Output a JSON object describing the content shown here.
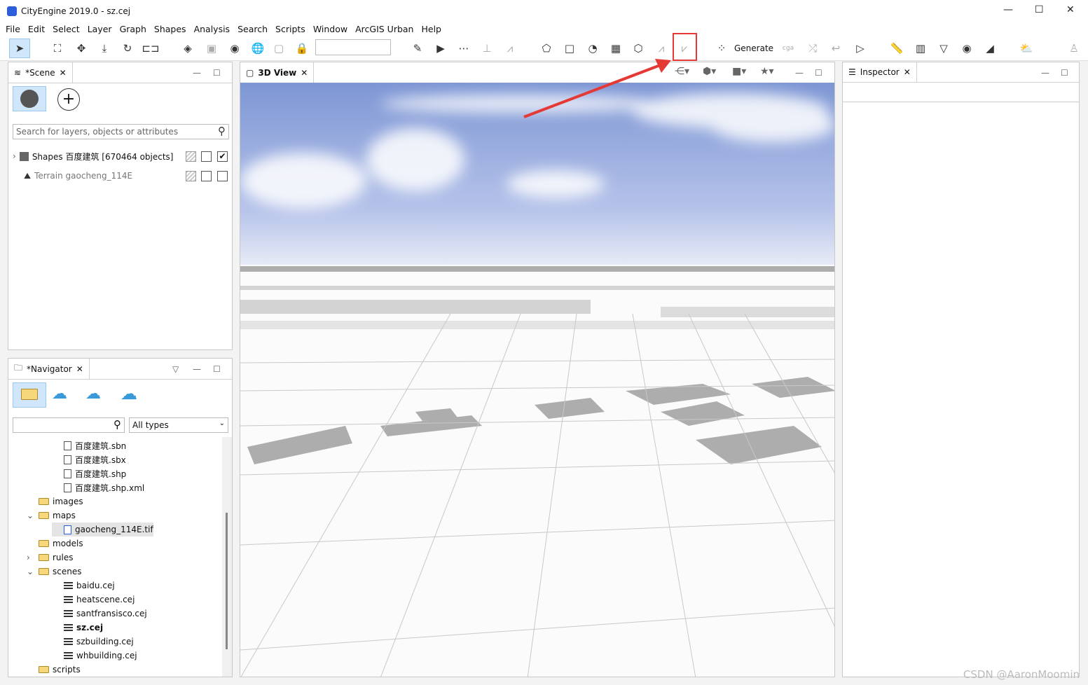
{
  "window": {
    "title": "CityEngine 2019.0 - sz.cej"
  },
  "menu": [
    "File",
    "Edit",
    "Select",
    "Layer",
    "Graph",
    "Shapes",
    "Analysis",
    "Search",
    "Scripts",
    "Window",
    "ArcGIS Urban",
    "Help"
  ],
  "toolbar": {
    "generate_label": "Generate",
    "cga_label": "cga",
    "highlight_color": "#e53935"
  },
  "scene": {
    "tab": "*Scene",
    "search_placeholder": "Search for layers, objects or attributes",
    "layers": [
      {
        "label": "Shapes 百度建筑 [670464 objects]",
        "visible": true,
        "icon": "cube-icon"
      },
      {
        "label": "Terrain gaocheng_114E",
        "visible": false,
        "icon": "terrain-icon"
      }
    ]
  },
  "navigator": {
    "tab": "*Navigator",
    "filter_value": "All types",
    "items": [
      {
        "label": "百度建筑.sbn",
        "type": "file",
        "indent": 3
      },
      {
        "label": "百度建筑.sbx",
        "type": "file",
        "indent": 3
      },
      {
        "label": "百度建筑.shp",
        "type": "shp",
        "indent": 3
      },
      {
        "label": "百度建筑.shp.xml",
        "type": "file",
        "indent": 3
      },
      {
        "label": "images",
        "type": "folder",
        "indent": 2
      },
      {
        "label": "maps",
        "type": "folder-open",
        "indent": 2
      },
      {
        "label": "gaocheng_114E.tif",
        "type": "image",
        "indent": 3,
        "selected": true
      },
      {
        "label": "models",
        "type": "folder",
        "indent": 2
      },
      {
        "label": "rules",
        "type": "folder-collapsed",
        "indent": 2
      },
      {
        "label": "scenes",
        "type": "folder-open",
        "indent": 2
      },
      {
        "label": "baidu.cej",
        "type": "scene",
        "indent": 3
      },
      {
        "label": "heatscene.cej",
        "type": "scene",
        "indent": 3
      },
      {
        "label": "santfransisco.cej",
        "type": "scene",
        "indent": 3
      },
      {
        "label": "sz.cej",
        "type": "scene",
        "indent": 3,
        "bold": true
      },
      {
        "label": "szbuilding.cej",
        "type": "scene",
        "indent": 3
      },
      {
        "label": "whbuilding.cej",
        "type": "scene",
        "indent": 3
      },
      {
        "label": "scripts",
        "type": "folder",
        "indent": 2
      }
    ]
  },
  "view3d": {
    "tab": "3D View"
  },
  "inspector": {
    "tab": "Inspector"
  },
  "watermark": "CSDN @AaronMoomin"
}
